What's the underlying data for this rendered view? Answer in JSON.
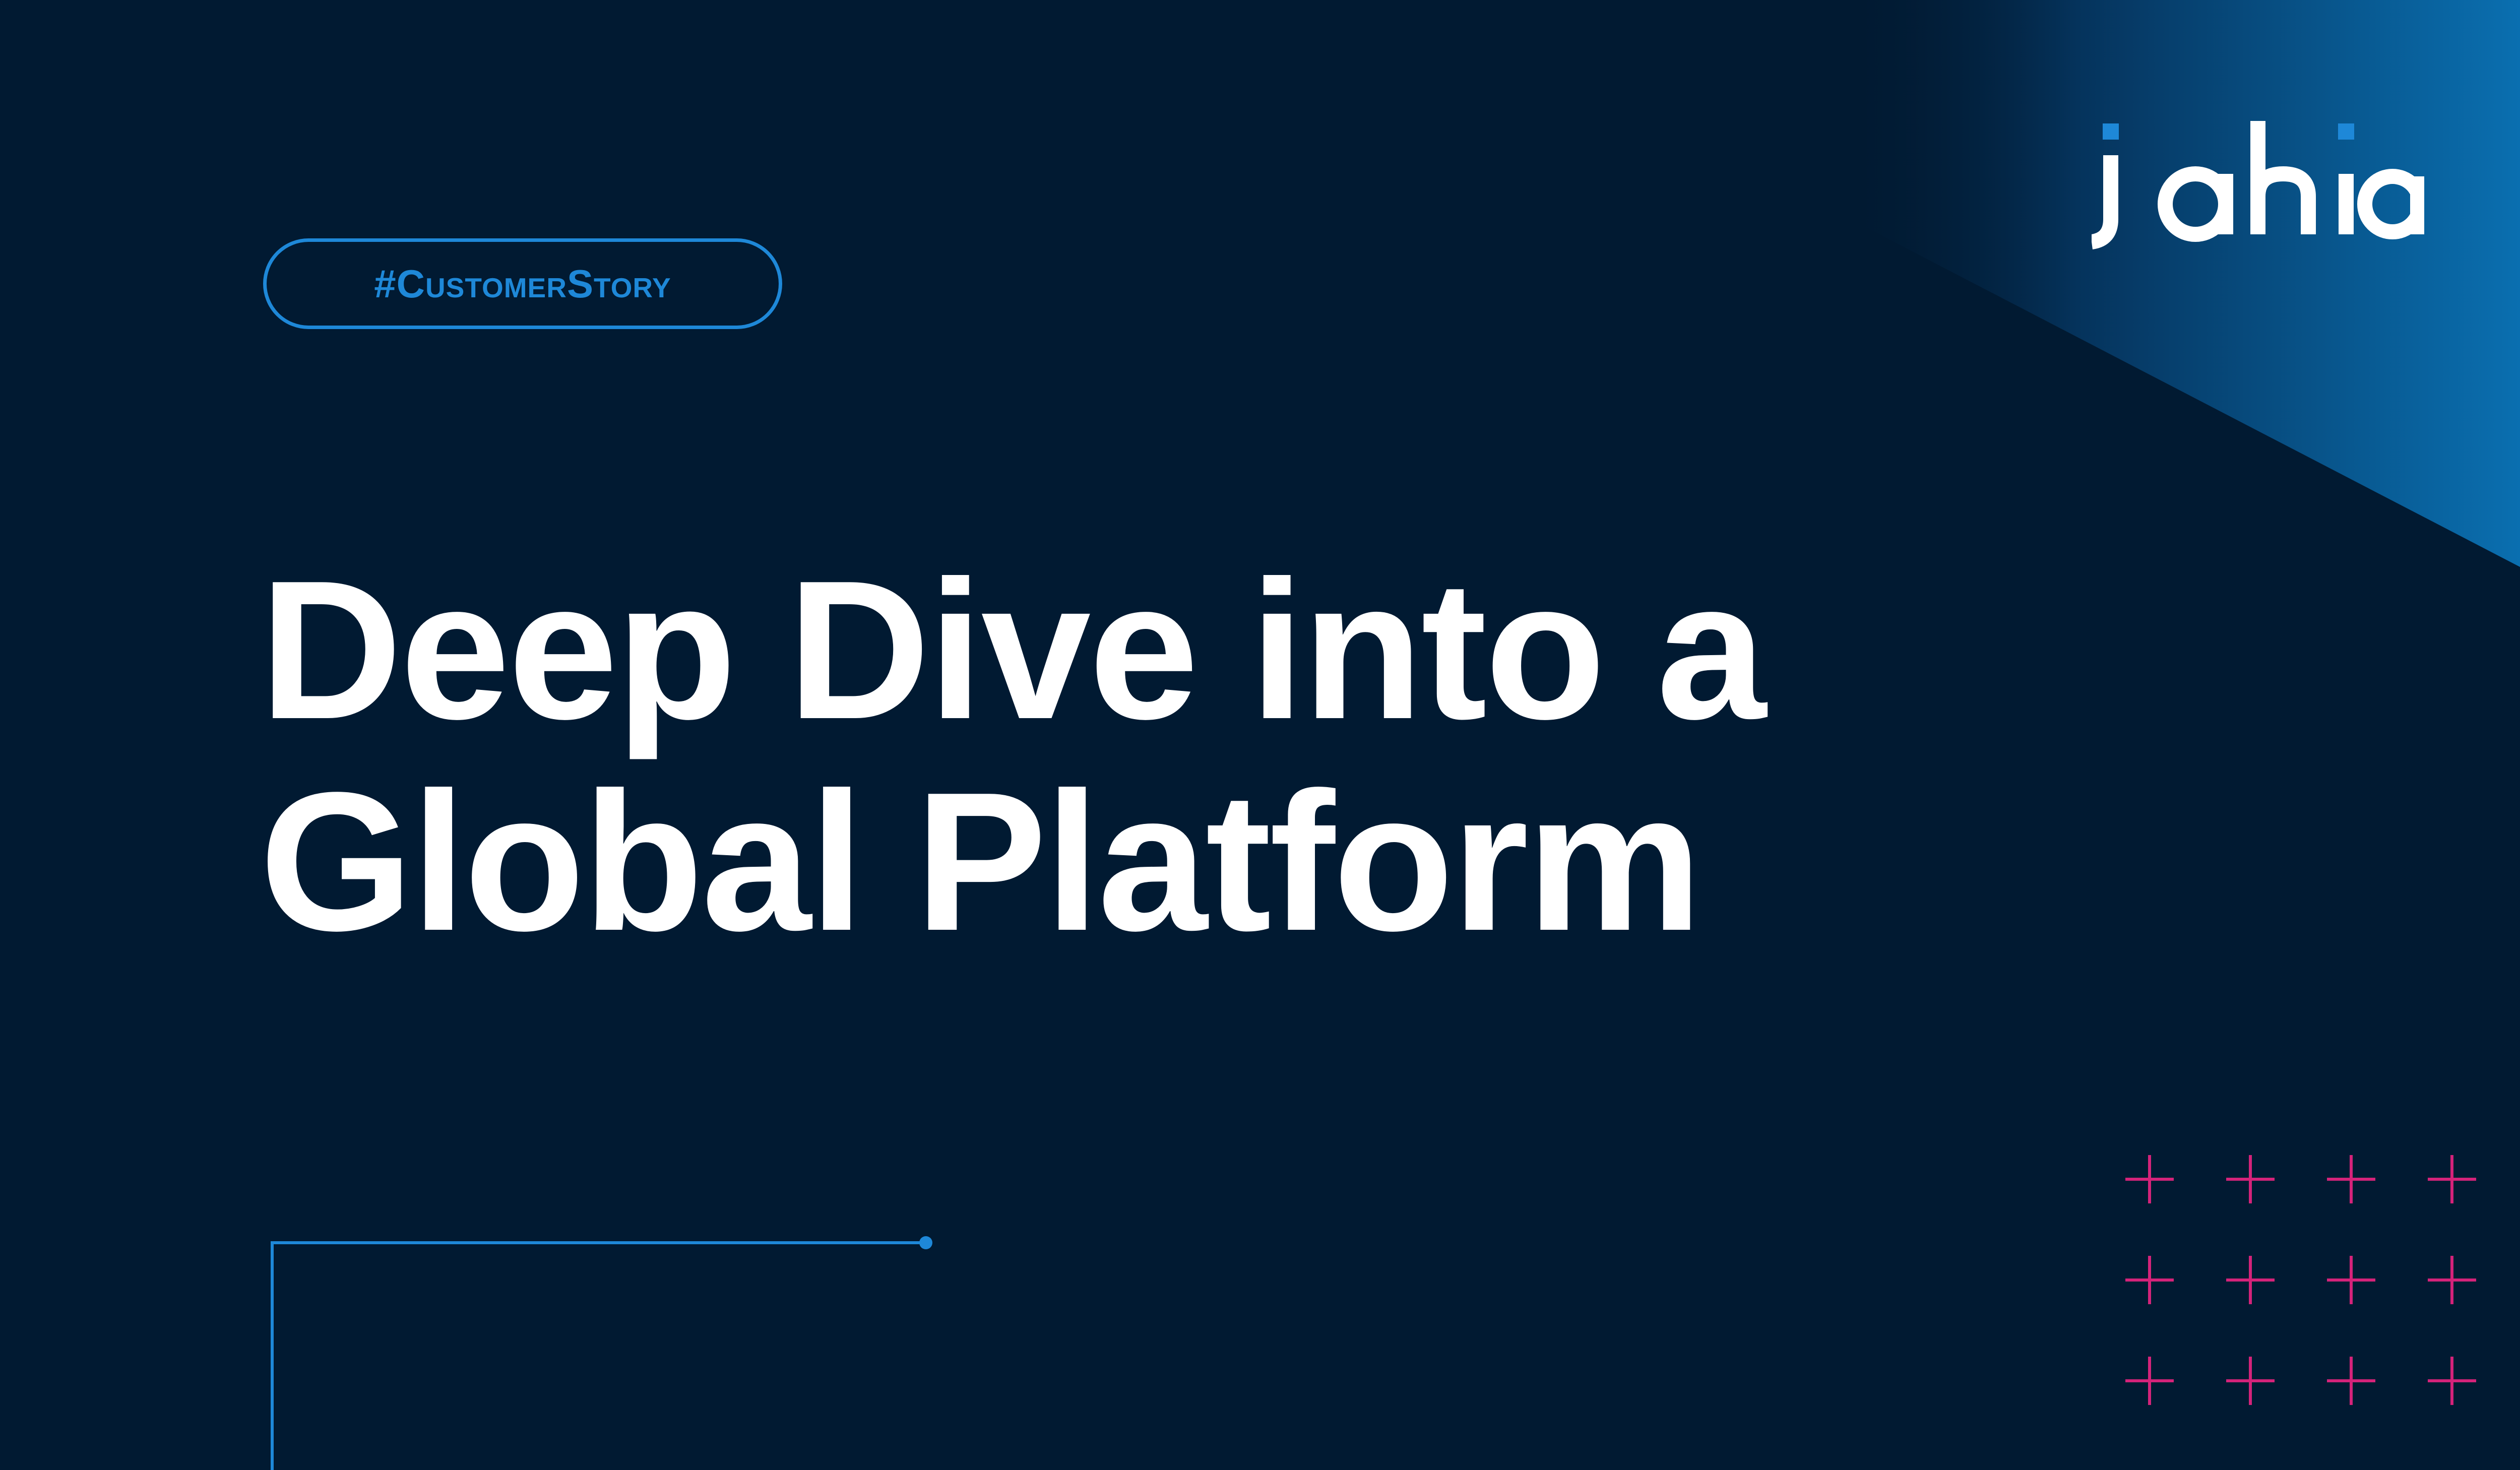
{
  "tag": {
    "label": "#CustomerStory"
  },
  "headline": {
    "line1": "Deep Dive into a",
    "line2": "Global Platform"
  },
  "brand": {
    "logo_text": "jahia",
    "icon": "jahia-logo"
  },
  "colors": {
    "background": "#011a32",
    "accent_blue": "#1e88d8",
    "gradient_blue": "#0a74b8",
    "plus_magenta": "#d4237a",
    "text": "#ffffff"
  },
  "decorations": {
    "plus_grid": {
      "rows": 3,
      "cols": 4,
      "icon": "plus-icon"
    },
    "connector_icon": "bracket-line"
  }
}
